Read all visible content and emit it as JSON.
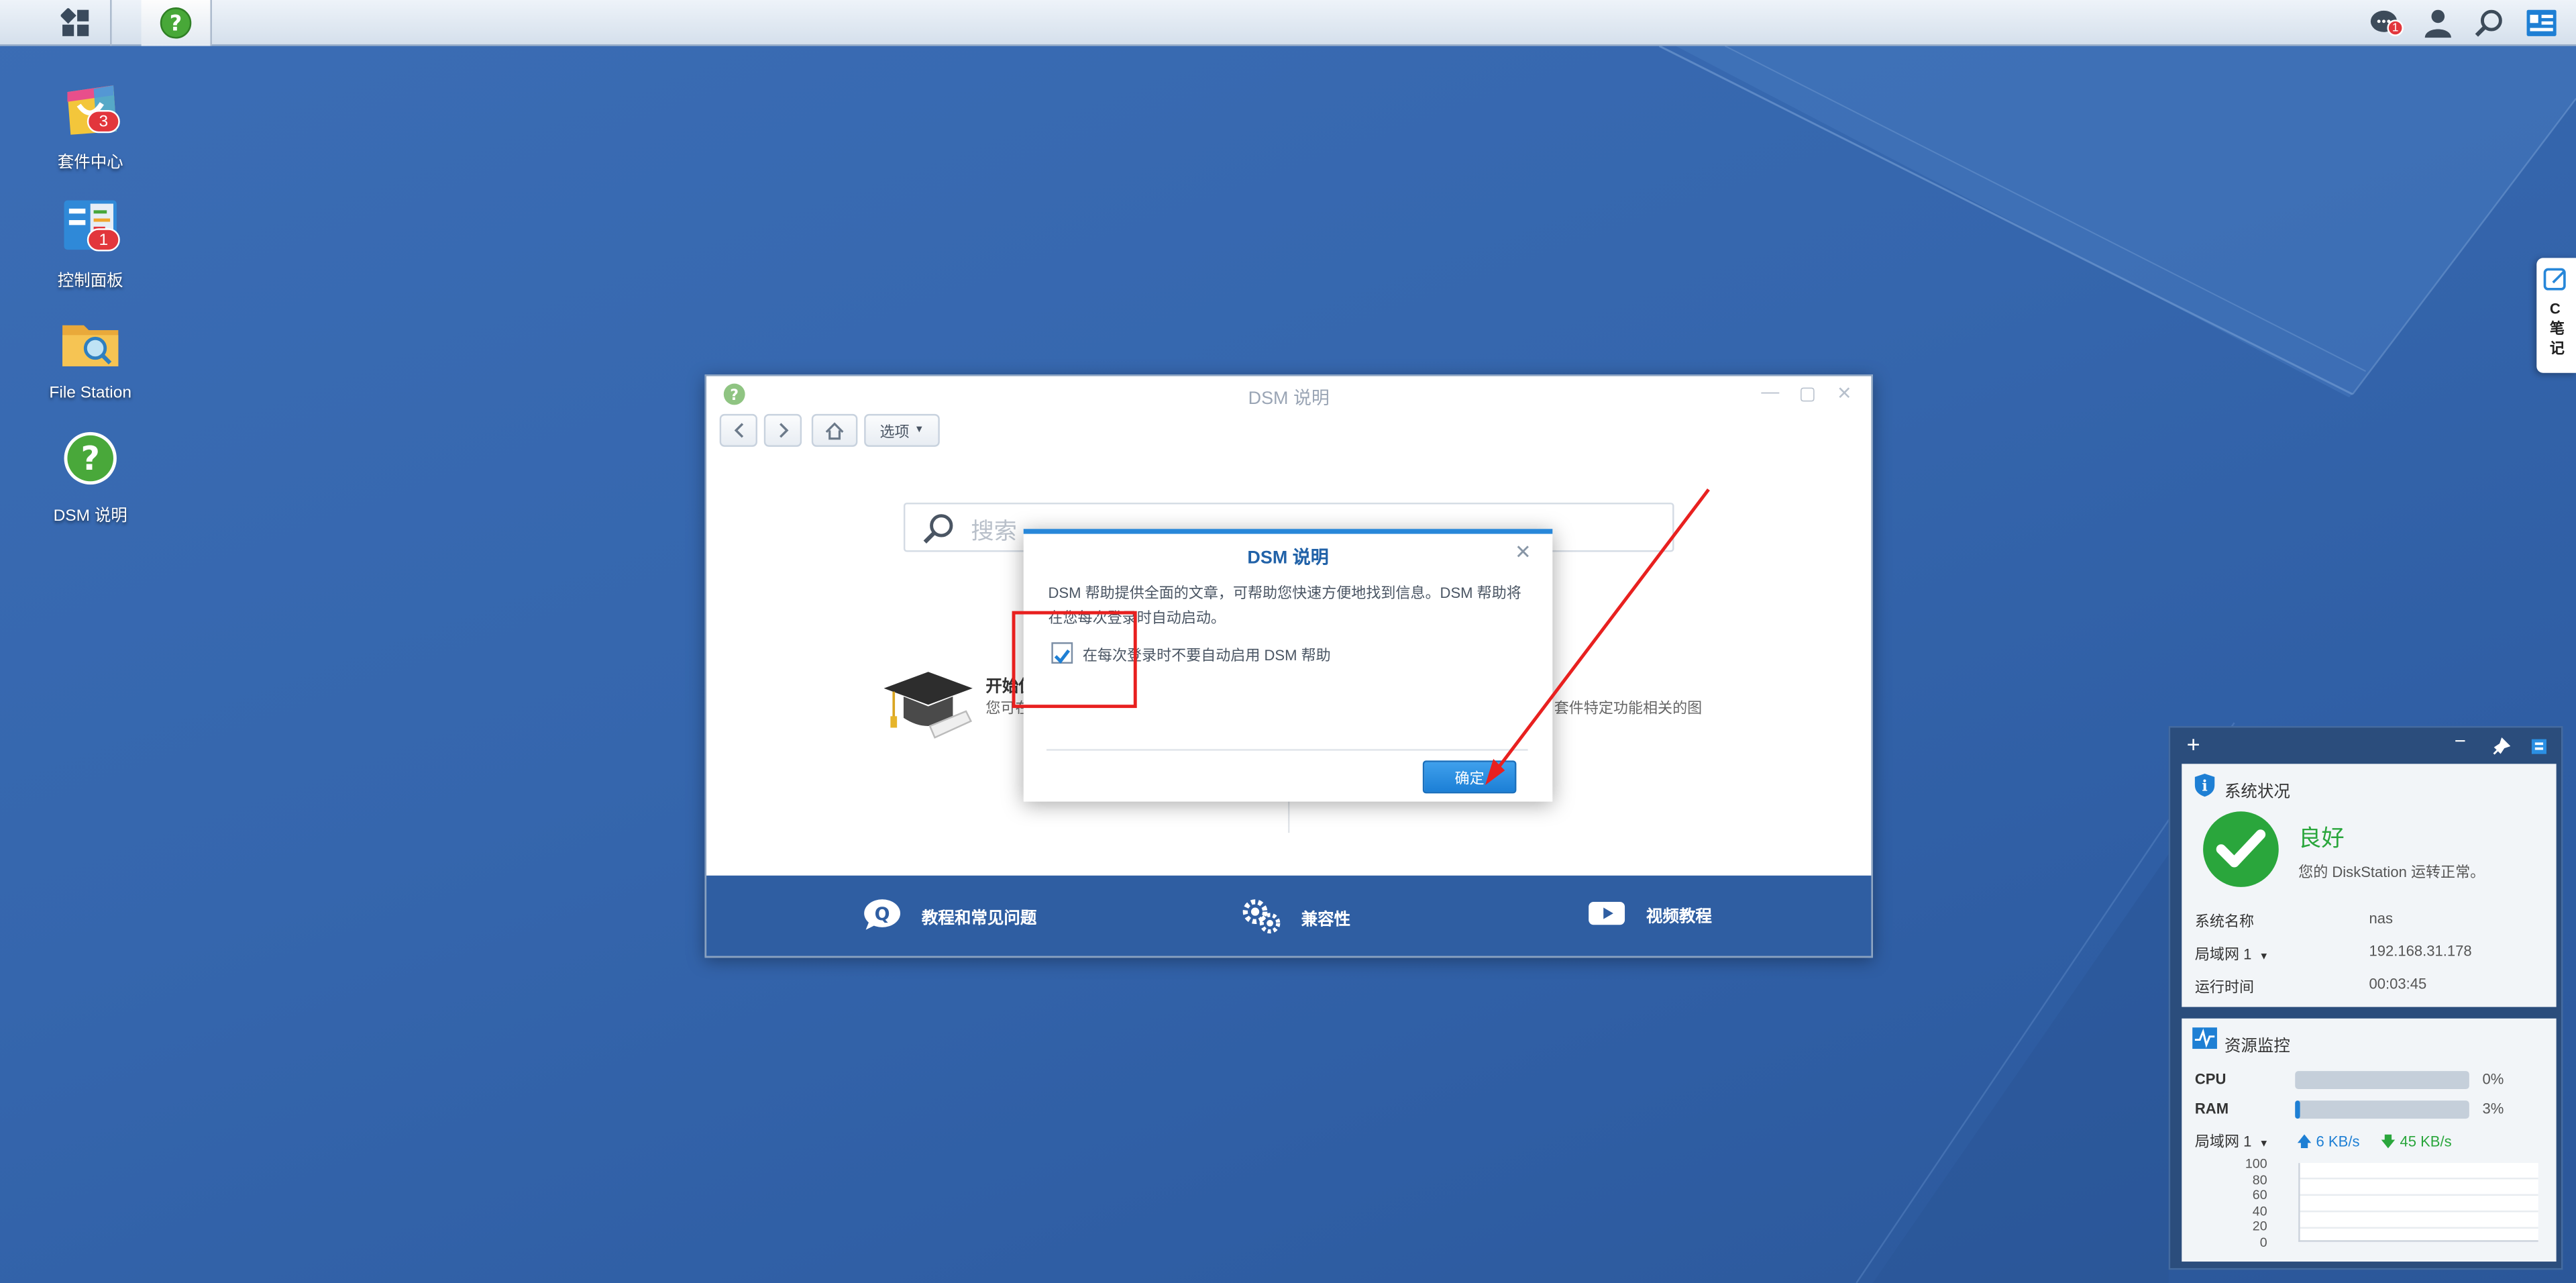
{
  "desktop": {
    "icons": [
      {
        "label": "套件中心",
        "badge": "3"
      },
      {
        "label": "控制面板",
        "badge": "1"
      },
      {
        "label": "File Station",
        "badge": ""
      },
      {
        "label": "DSM 说明",
        "badge": ""
      }
    ]
  },
  "taskbar": {
    "notification_badge": "1"
  },
  "side_tab": {
    "label_c": "C",
    "label_1": "笔",
    "label_2": "记"
  },
  "help_window": {
    "title": "DSM 说明",
    "options_label": "选项",
    "search_placeholder": "搜索",
    "getting_started_title": "开始使",
    "getting_started_desc": "您可在",
    "right_desc": "套件特定功能相关的图",
    "footer": {
      "faq": "教程和常见问题",
      "compat": "兼容性",
      "video": "视频教程"
    }
  },
  "dialog": {
    "title": "DSM 说明",
    "text": "DSM 帮助提供全面的文章，可帮助您快速方便地找到信息。DSM 帮助将在您每次登录时自动启动。",
    "checkbox_label": "在每次登录时不要自动启用 DSM 帮助",
    "checkbox_checked": true,
    "ok_label": "确定"
  },
  "widget": {
    "system_status": {
      "title": "系统状况",
      "status": "良好",
      "status_desc": "您的 DiskStation 运转正常。",
      "rows": [
        {
          "label": "系统名称",
          "value": "nas"
        },
        {
          "label": "局域网 1",
          "value": "192.168.31.178"
        },
        {
          "label": "运行时间",
          "value": "00:03:45"
        }
      ]
    },
    "resource_monitor": {
      "title": "资源监控",
      "cpu_label": "CPU",
      "cpu_value": "0%",
      "cpu_level": 0,
      "ram_label": "RAM",
      "ram_value": "3%",
      "ram_level": 3,
      "lan_label": "局域网 1",
      "upload": "6 KB/s",
      "download": "45 KB/s",
      "y_ticks": [
        "100",
        "80",
        "60",
        "40",
        "20",
        "0"
      ]
    }
  },
  "colors": {
    "accent": "#2787d9",
    "good": "#2aa63c",
    "annotation": "#e8201f"
  }
}
